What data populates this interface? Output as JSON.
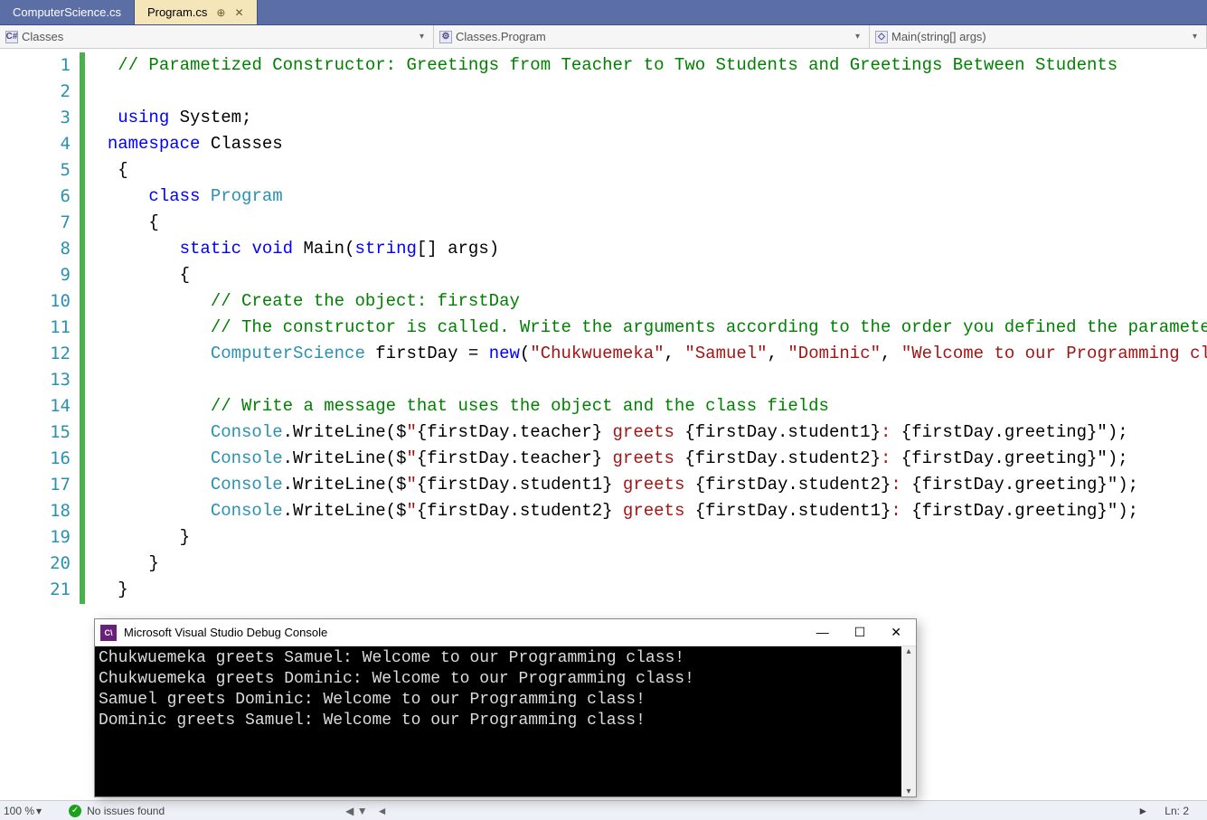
{
  "tabs": [
    {
      "label": "ComputerScience.cs",
      "active": false
    },
    {
      "label": "Program.cs",
      "active": true
    }
  ],
  "nav": {
    "scope_icon": "C#",
    "scope": "Classes",
    "class_icon": "⚙",
    "class": "Classes.Program",
    "method_icon": "◇",
    "method": "Main(string[] args)"
  },
  "code": {
    "line_numbers": [
      "1",
      "2",
      "3",
      "4",
      "5",
      "6",
      "7",
      "8",
      "9",
      "10",
      "11",
      "12",
      "13",
      "14",
      "15",
      "16",
      "17",
      "18",
      "19",
      "20",
      "21"
    ],
    "l1_comment": "// Parametized Constructor: Greetings from Teacher to Two Students and Greetings Between Students",
    "l3_using": "using",
    "l3_ns": " System;",
    "l4_ns": "namespace",
    "l4_name": " Classes",
    "l5": "{",
    "l6_class": "class",
    "l6_name": " Program",
    "l7": "{",
    "l8_static": "static",
    "l8_void": " void",
    "l8_main": " Main(",
    "l8_string": "string",
    "l8_rest": "[] args)",
    "l9": "{",
    "l10_comment": "// Create the object: firstDay",
    "l11_comment": "// The constructor is called. Write the arguments according to the order you defined the parameters.",
    "l12_type": "ComputerScience",
    "l12_var": " firstDay = ",
    "l12_new": "new",
    "l12_open": "(",
    "l12_s1": "\"Chukwuemeka\"",
    "l12_c1": ", ",
    "l12_s2": "\"Samuel\"",
    "l12_c2": ", ",
    "l12_s3": "\"Dominic\"",
    "l12_c3": ", ",
    "l12_s4": "\"Welcome to our Programming class!\"",
    "l12_close": ");",
    "l14_comment": "// Write a message that uses the object and the class fields",
    "cw": "Console",
    "dot_wl": ".WriteLine($",
    "q": "\"",
    "ob": "{",
    "cb": "}",
    "fd": "firstDay",
    "teacher": ".teacher",
    "student1": ".student1",
    "student2": ".student2",
    "greeting": ".greeting",
    "greets": " greets ",
    "colon": ": ",
    "endp": "\");",
    "l19": "}",
    "l20": "}",
    "l21": "}"
  },
  "console": {
    "title": "Microsoft Visual Studio Debug Console",
    "lines": [
      "Chukwuemeka greets Samuel: Welcome to our Programming class!",
      "Chukwuemeka greets Dominic: Welcome to our Programming class!",
      "Samuel greets Dominic: Welcome to our Programming class!",
      "Dominic greets Samuel: Welcome to our Programming class!"
    ]
  },
  "status": {
    "zoom": "100 %",
    "issues": "No issues found",
    "ln": "Ln: 2"
  }
}
